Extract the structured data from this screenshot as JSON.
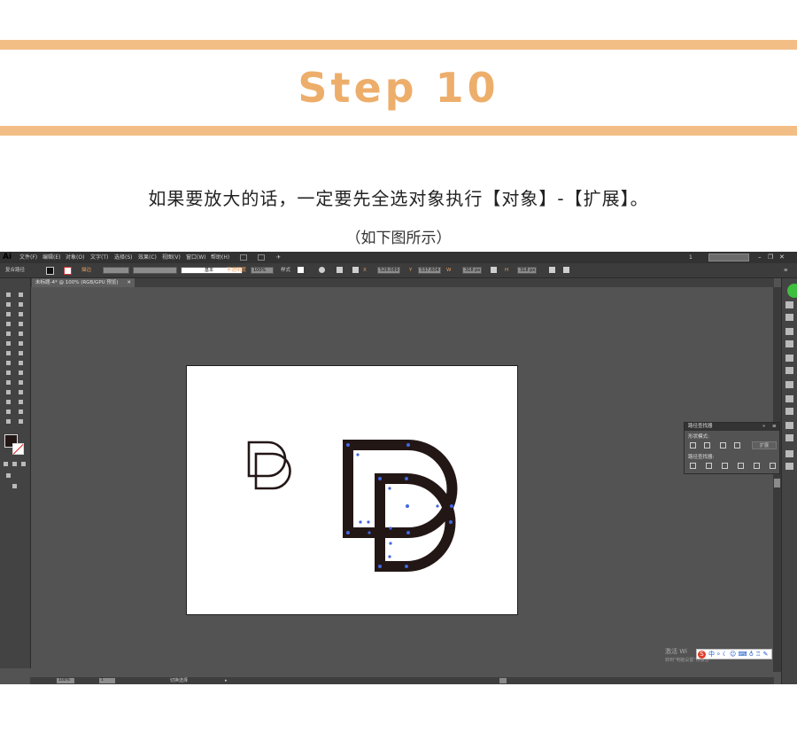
{
  "colors": {
    "accent": "#F3BE85",
    "title": "#EDAE6B",
    "mark": "#231716",
    "selection": "#4466E0"
  },
  "header": {
    "title": "Step 10"
  },
  "instruction": "如果要放大的话，一定要先全选对象执行【对象】-【扩展】。",
  "caption": "（如下图所示）",
  "app": {
    "logo": "Ai",
    "menu": [
      "文件(F)",
      "编辑(E)",
      "对象(O)",
      "文字(T)",
      "选择(S)",
      "效果(C)",
      "视图(V)",
      "窗口(W)",
      "帮助(H)"
    ],
    "workspace_num": "1",
    "control": {
      "selection_label": "复合路径",
      "stroke_label": "描边",
      "stroke_style": "基本",
      "opacity_label": "不透明度",
      "opacity_value": "100%",
      "style_label": "样式",
      "x_value": "526.089",
      "y_value": "537.604",
      "w_value": "318 px",
      "h_value": "318 px"
    },
    "doc_tab": "未标题-4* @ 100% (RGB/GPU 预览)",
    "pathfinder": {
      "title": "路径查找器",
      "shape_modes": "形状模式:",
      "expand_button": "扩展",
      "pathfinders": "路径查找器:"
    },
    "status": {
      "zoom": "100%",
      "page": "1",
      "tool": "切换选择"
    },
    "activation": {
      "title": "激活 Wi",
      "hint": "转到\"电脑设置\"以激活"
    }
  }
}
